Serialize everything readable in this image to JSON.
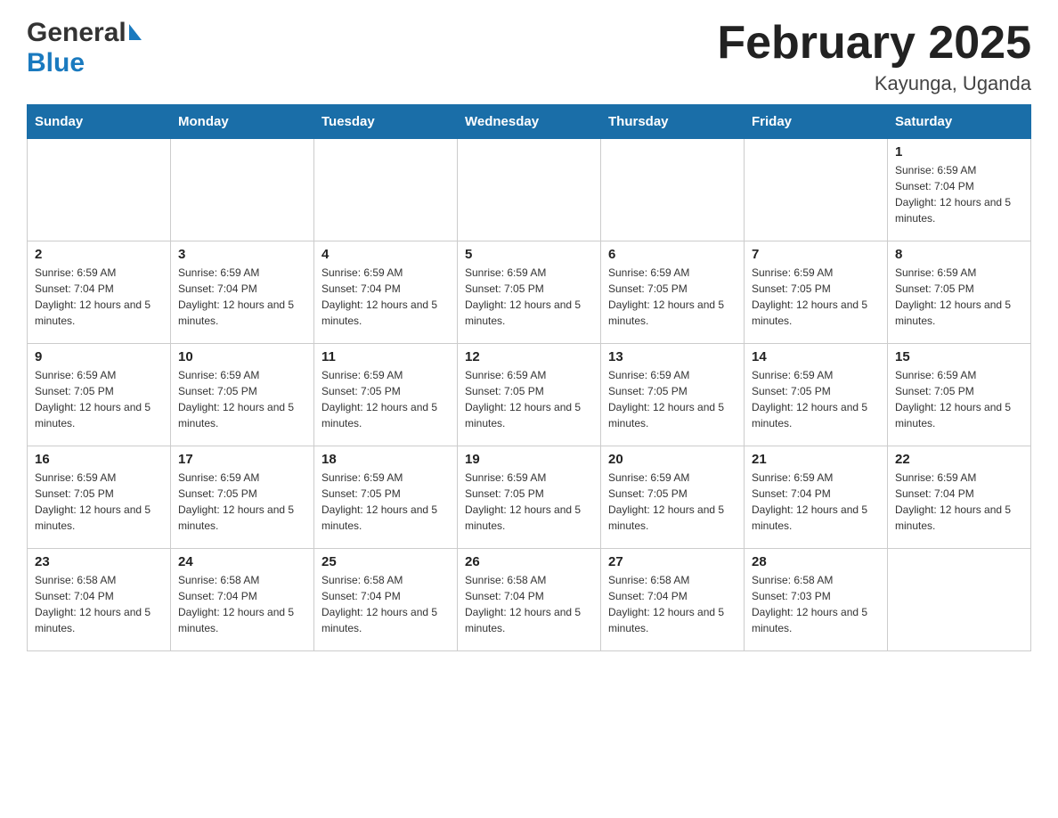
{
  "header": {
    "logo_general": "General",
    "logo_blue": "Blue",
    "month_title": "February 2025",
    "location": "Kayunga, Uganda"
  },
  "weekdays": [
    "Sunday",
    "Monday",
    "Tuesday",
    "Wednesday",
    "Thursday",
    "Friday",
    "Saturday"
  ],
  "weeks": [
    {
      "days": [
        {
          "date": "",
          "sunrise": "",
          "sunset": "",
          "daylight": ""
        },
        {
          "date": "",
          "sunrise": "",
          "sunset": "",
          "daylight": ""
        },
        {
          "date": "",
          "sunrise": "",
          "sunset": "",
          "daylight": ""
        },
        {
          "date": "",
          "sunrise": "",
          "sunset": "",
          "daylight": ""
        },
        {
          "date": "",
          "sunrise": "",
          "sunset": "",
          "daylight": ""
        },
        {
          "date": "",
          "sunrise": "",
          "sunset": "",
          "daylight": ""
        },
        {
          "date": "1",
          "sunrise": "Sunrise: 6:59 AM",
          "sunset": "Sunset: 7:04 PM",
          "daylight": "Daylight: 12 hours and 5 minutes."
        }
      ]
    },
    {
      "days": [
        {
          "date": "2",
          "sunrise": "Sunrise: 6:59 AM",
          "sunset": "Sunset: 7:04 PM",
          "daylight": "Daylight: 12 hours and 5 minutes."
        },
        {
          "date": "3",
          "sunrise": "Sunrise: 6:59 AM",
          "sunset": "Sunset: 7:04 PM",
          "daylight": "Daylight: 12 hours and 5 minutes."
        },
        {
          "date": "4",
          "sunrise": "Sunrise: 6:59 AM",
          "sunset": "Sunset: 7:04 PM",
          "daylight": "Daylight: 12 hours and 5 minutes."
        },
        {
          "date": "5",
          "sunrise": "Sunrise: 6:59 AM",
          "sunset": "Sunset: 7:05 PM",
          "daylight": "Daylight: 12 hours and 5 minutes."
        },
        {
          "date": "6",
          "sunrise": "Sunrise: 6:59 AM",
          "sunset": "Sunset: 7:05 PM",
          "daylight": "Daylight: 12 hours and 5 minutes."
        },
        {
          "date": "7",
          "sunrise": "Sunrise: 6:59 AM",
          "sunset": "Sunset: 7:05 PM",
          "daylight": "Daylight: 12 hours and 5 minutes."
        },
        {
          "date": "8",
          "sunrise": "Sunrise: 6:59 AM",
          "sunset": "Sunset: 7:05 PM",
          "daylight": "Daylight: 12 hours and 5 minutes."
        }
      ]
    },
    {
      "days": [
        {
          "date": "9",
          "sunrise": "Sunrise: 6:59 AM",
          "sunset": "Sunset: 7:05 PM",
          "daylight": "Daylight: 12 hours and 5 minutes."
        },
        {
          "date": "10",
          "sunrise": "Sunrise: 6:59 AM",
          "sunset": "Sunset: 7:05 PM",
          "daylight": "Daylight: 12 hours and 5 minutes."
        },
        {
          "date": "11",
          "sunrise": "Sunrise: 6:59 AM",
          "sunset": "Sunset: 7:05 PM",
          "daylight": "Daylight: 12 hours and 5 minutes."
        },
        {
          "date": "12",
          "sunrise": "Sunrise: 6:59 AM",
          "sunset": "Sunset: 7:05 PM",
          "daylight": "Daylight: 12 hours and 5 minutes."
        },
        {
          "date": "13",
          "sunrise": "Sunrise: 6:59 AM",
          "sunset": "Sunset: 7:05 PM",
          "daylight": "Daylight: 12 hours and 5 minutes."
        },
        {
          "date": "14",
          "sunrise": "Sunrise: 6:59 AM",
          "sunset": "Sunset: 7:05 PM",
          "daylight": "Daylight: 12 hours and 5 minutes."
        },
        {
          "date": "15",
          "sunrise": "Sunrise: 6:59 AM",
          "sunset": "Sunset: 7:05 PM",
          "daylight": "Daylight: 12 hours and 5 minutes."
        }
      ]
    },
    {
      "days": [
        {
          "date": "16",
          "sunrise": "Sunrise: 6:59 AM",
          "sunset": "Sunset: 7:05 PM",
          "daylight": "Daylight: 12 hours and 5 minutes."
        },
        {
          "date": "17",
          "sunrise": "Sunrise: 6:59 AM",
          "sunset": "Sunset: 7:05 PM",
          "daylight": "Daylight: 12 hours and 5 minutes."
        },
        {
          "date": "18",
          "sunrise": "Sunrise: 6:59 AM",
          "sunset": "Sunset: 7:05 PM",
          "daylight": "Daylight: 12 hours and 5 minutes."
        },
        {
          "date": "19",
          "sunrise": "Sunrise: 6:59 AM",
          "sunset": "Sunset: 7:05 PM",
          "daylight": "Daylight: 12 hours and 5 minutes."
        },
        {
          "date": "20",
          "sunrise": "Sunrise: 6:59 AM",
          "sunset": "Sunset: 7:05 PM",
          "daylight": "Daylight: 12 hours and 5 minutes."
        },
        {
          "date": "21",
          "sunrise": "Sunrise: 6:59 AM",
          "sunset": "Sunset: 7:04 PM",
          "daylight": "Daylight: 12 hours and 5 minutes."
        },
        {
          "date": "22",
          "sunrise": "Sunrise: 6:59 AM",
          "sunset": "Sunset: 7:04 PM",
          "daylight": "Daylight: 12 hours and 5 minutes."
        }
      ]
    },
    {
      "days": [
        {
          "date": "23",
          "sunrise": "Sunrise: 6:58 AM",
          "sunset": "Sunset: 7:04 PM",
          "daylight": "Daylight: 12 hours and 5 minutes."
        },
        {
          "date": "24",
          "sunrise": "Sunrise: 6:58 AM",
          "sunset": "Sunset: 7:04 PM",
          "daylight": "Daylight: 12 hours and 5 minutes."
        },
        {
          "date": "25",
          "sunrise": "Sunrise: 6:58 AM",
          "sunset": "Sunset: 7:04 PM",
          "daylight": "Daylight: 12 hours and 5 minutes."
        },
        {
          "date": "26",
          "sunrise": "Sunrise: 6:58 AM",
          "sunset": "Sunset: 7:04 PM",
          "daylight": "Daylight: 12 hours and 5 minutes."
        },
        {
          "date": "27",
          "sunrise": "Sunrise: 6:58 AM",
          "sunset": "Sunset: 7:04 PM",
          "daylight": "Daylight: 12 hours and 5 minutes."
        },
        {
          "date": "28",
          "sunrise": "Sunrise: 6:58 AM",
          "sunset": "Sunset: 7:03 PM",
          "daylight": "Daylight: 12 hours and 5 minutes."
        },
        {
          "date": "",
          "sunrise": "",
          "sunset": "",
          "daylight": ""
        }
      ]
    }
  ]
}
